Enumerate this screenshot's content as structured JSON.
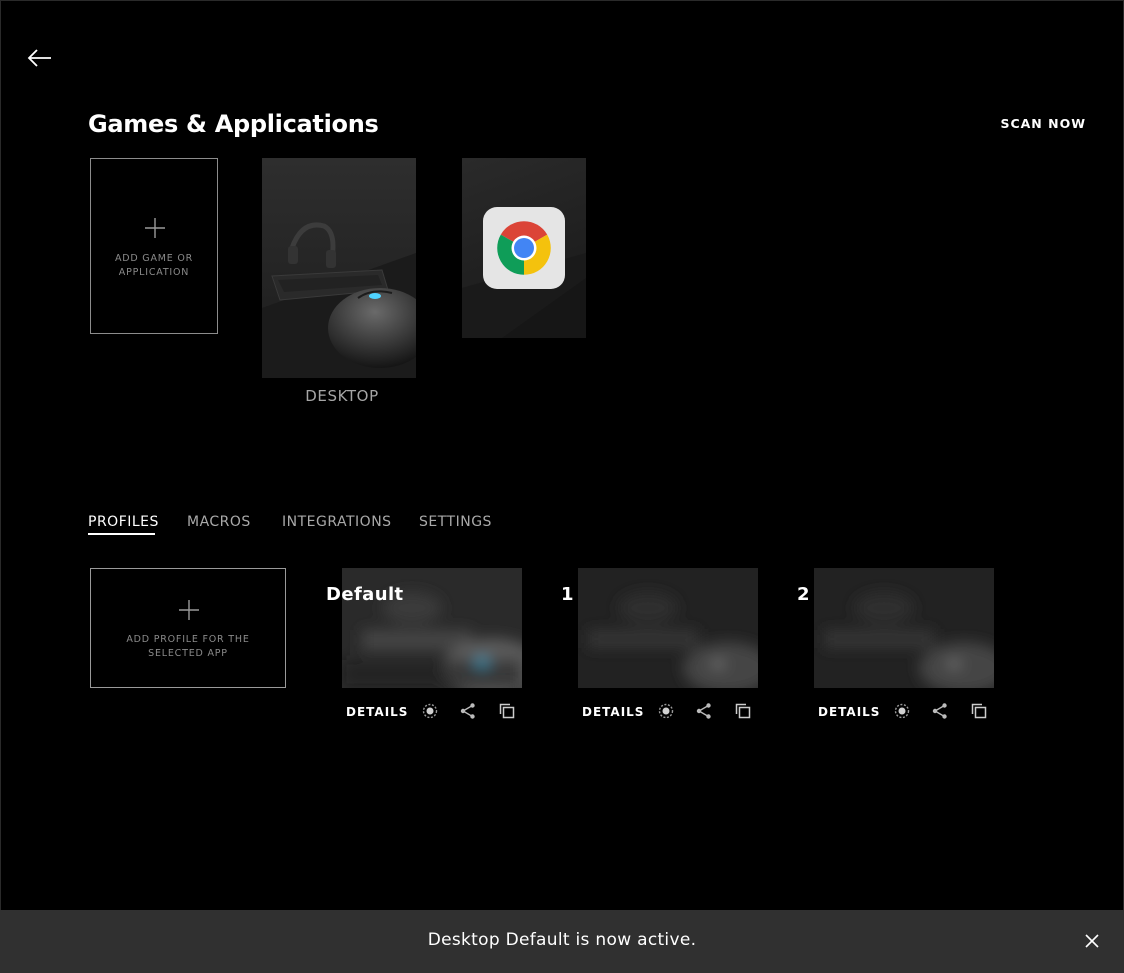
{
  "header": {
    "back_icon": "arrow-left-icon",
    "title": "Games & Applications",
    "scan_label": "SCAN NOW"
  },
  "games": {
    "add_label_line1": "ADD GAME OR",
    "add_label_line2": "APPLICATION",
    "tiles": [
      {
        "label": "DESKTOP",
        "icon": "desktop-photo"
      },
      {
        "label": "",
        "icon": "chrome-icon"
      }
    ]
  },
  "tabs": [
    {
      "label": "PROFILES",
      "active": true
    },
    {
      "label": "MACROS",
      "active": false
    },
    {
      "label": "INTEGRATIONS",
      "active": false
    },
    {
      "label": "SETTINGS",
      "active": false
    }
  ],
  "profiles": {
    "add_label_line1": "ADD PROFILE FOR THE",
    "add_label_line2": "SELECTED APP",
    "items": [
      {
        "name": "Default",
        "details_label": "DETAILS"
      },
      {
        "name": "1",
        "details_label": "DETAILS"
      },
      {
        "name": "2",
        "details_label": "DETAILS"
      }
    ],
    "action_icons": [
      "persistent-profile-icon",
      "share-icon",
      "duplicate-icon"
    ]
  },
  "toast": {
    "message": "Desktop Default is now active.",
    "close_icon": "close-icon"
  },
  "colors": {
    "background": "#000000",
    "toast_bg": "#303030",
    "muted_text": "#a6a6a6",
    "accent_blue": "#4fd3ff"
  }
}
